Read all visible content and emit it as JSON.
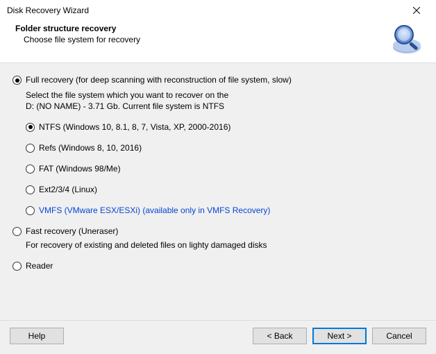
{
  "window": {
    "title": "Disk Recovery Wizard"
  },
  "header": {
    "title": "Folder structure recovery",
    "subtitle": "Choose file system for recovery"
  },
  "recovery": {
    "full": {
      "label": "Full recovery (for deep scanning with reconstruction of file system, slow)",
      "desc_line1": "Select the file system which you want to recover on the",
      "desc_line2": "D: (NO NAME) - 3.71 Gb. Current file system is NTFS",
      "selected": true,
      "filesystems": {
        "ntfs": {
          "label": "NTFS (Windows 10, 8.1, 8, 7, Vista, XP, 2000-2016)",
          "selected": true
        },
        "refs": {
          "label": "Refs (Windows 8, 10, 2016)",
          "selected": false
        },
        "fat": {
          "label": "FAT (Windows 98/Me)",
          "selected": false
        },
        "ext": {
          "label": "Ext2/3/4 (Linux)",
          "selected": false
        },
        "vmfs": {
          "label": "VMFS (VMware ESX/ESXi) (available only in VMFS Recovery)",
          "selected": false
        }
      }
    },
    "fast": {
      "label": "Fast recovery (Uneraser)",
      "desc": "For recovery of existing and deleted files on lighty damaged disks",
      "selected": false
    },
    "reader": {
      "label": "Reader",
      "selected": false
    }
  },
  "buttons": {
    "help": "Help",
    "back": "< Back",
    "next": "Next >",
    "cancel": "Cancel"
  }
}
